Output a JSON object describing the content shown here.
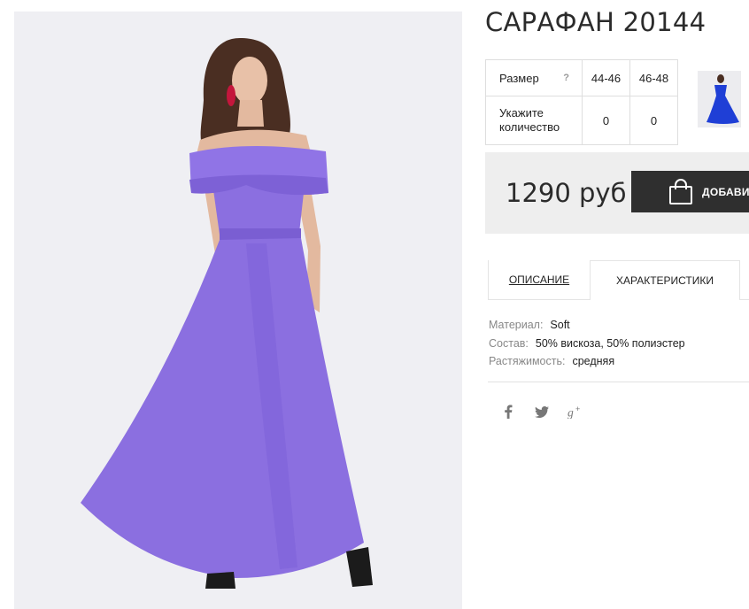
{
  "product": {
    "title": "САРАФАН 20144",
    "image_alt": "Sarafan photo",
    "colors": {
      "dress": "#8b6fe0",
      "background": "#efeff3",
      "thumb_dress": "#1f3fd6"
    }
  },
  "sizes": {
    "size_label": "Размер",
    "help": "?",
    "columns": [
      "44-46",
      "46-48"
    ],
    "qty_label_line1": "Укажите",
    "qty_label_line2": "количество",
    "quantities": [
      "0",
      "0"
    ]
  },
  "purchase": {
    "price": "1290 руб",
    "add_button": "ДОБАВИТЬ"
  },
  "tabs": [
    {
      "label": "ОПИСАНИЕ",
      "active": false
    },
    {
      "label": "ХАРАКТЕРИСТИКИ",
      "active": true
    }
  ],
  "specs": [
    {
      "key": "Материал:",
      "value": "Soft"
    },
    {
      "key": "Состав:",
      "value": "50% вискоза, 50% полиэстер"
    },
    {
      "key": "Растяжимость:",
      "value": "средняя"
    }
  ],
  "social": [
    {
      "icon": "facebook-icon",
      "glyph": "f"
    },
    {
      "icon": "twitter-icon",
      "glyph": ""
    },
    {
      "icon": "google-plus-icon",
      "glyph": "g+"
    }
  ]
}
